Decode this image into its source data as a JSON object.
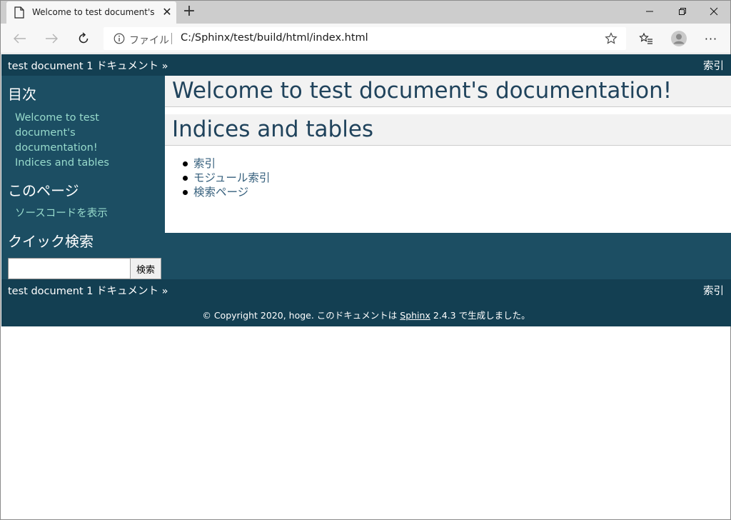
{
  "browser": {
    "tab_title": "Welcome to test document's doc",
    "address_scheme_label": "ファイル",
    "url": "C:/Sphinx/test/build/html/index.html"
  },
  "related": {
    "left": "test document 1 ドキュメント »",
    "right": "索引"
  },
  "sidebar": {
    "toc_title": "目次",
    "toc_links": [
      "Welcome to test",
      "document's",
      "documentation!",
      "Indices and tables"
    ],
    "this_page_title": "このページ",
    "show_source": "ソースコードを表示",
    "quick_search_title": "クイック検索",
    "search_button": "検索",
    "search_value": ""
  },
  "main": {
    "h1": "Welcome to test document's documentation!",
    "h2": "Indices and tables",
    "links": [
      "索引",
      "モジュール索引",
      "検索ページ"
    ]
  },
  "footer": {
    "prefix": "© Copyright 2020, hoge. このドキュメントは ",
    "link": "Sphinx",
    "suffix": " 2.4.3 で生成しました。"
  },
  "colors": {
    "related_bar": "#133f52",
    "sidebar_bg": "#1c4e63",
    "sidebar_link": "#98dbcc",
    "heading_text": "#20435c",
    "body_link": "#355f7c"
  }
}
